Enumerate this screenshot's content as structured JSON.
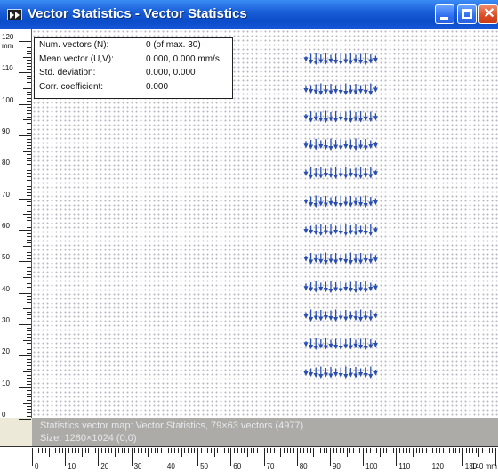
{
  "window": {
    "title": "Vector Statistics - Vector Statistics",
    "titlebar_color": "#0b4cc9",
    "buttons": {
      "minimize": "minimize-icon",
      "maximize": "maximize-icon",
      "close": "close-icon"
    }
  },
  "stats": {
    "rows": [
      {
        "label": "Num. vectors (N):",
        "value": "0  (of max. 30)"
      },
      {
        "label": "Mean vector (U,V):",
        "value": "0.000, 0.000 mm/s"
      },
      {
        "label": "Std. deviation:",
        "value": "0.000, 0.000"
      },
      {
        "label": "Corr. coefficient:",
        "value": "0.000"
      }
    ]
  },
  "status": {
    "line1": "Statistics vector map: Vector Statistics, 79×63 vectors (4977)",
    "line2": "Size: 1280×1024 (0,0)"
  },
  "rulers": {
    "unit": "mm",
    "y_labels": [
      "120",
      "110",
      "100",
      "90",
      "80",
      "70",
      "60",
      "50",
      "40",
      "30",
      "20",
      "10",
      "0"
    ],
    "x_labels": [
      "0",
      "10",
      "20",
      "30",
      "40",
      "50",
      "60",
      "70",
      "80",
      "90",
      "100",
      "110",
      "120",
      "130",
      "140 mm"
    ]
  },
  "vector_color": "#2a4fb0"
}
